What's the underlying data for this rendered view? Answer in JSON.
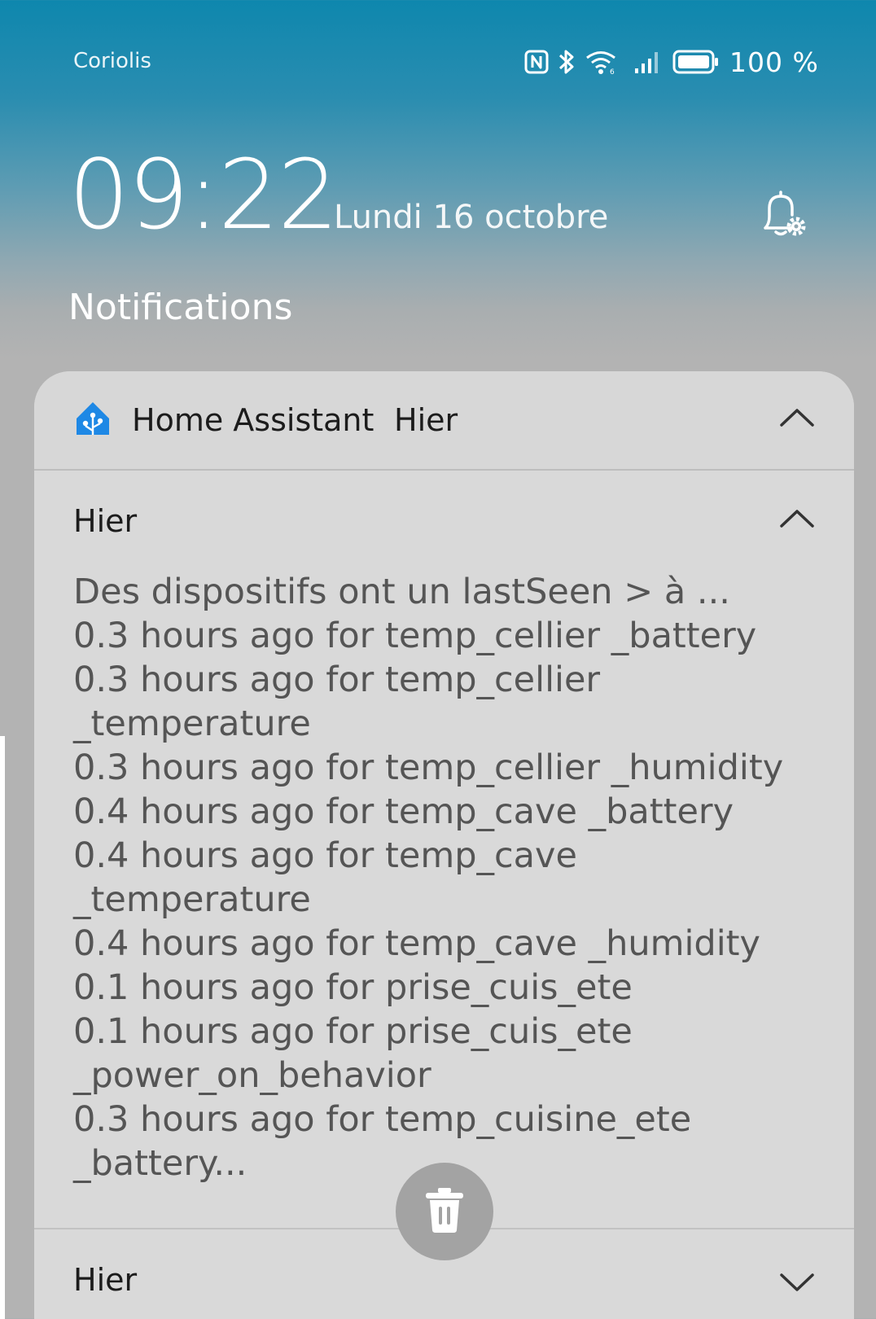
{
  "status_bar": {
    "carrier": "Coriolis",
    "battery_text": "100 %",
    "icons": [
      "nfc-icon",
      "bluetooth-icon",
      "wifi-icon",
      "signal-icon",
      "battery-icon"
    ]
  },
  "lockscreen": {
    "time": "09:22",
    "date": "Lundi 16 octobre",
    "bell_icon": "notification-settings-icon"
  },
  "section_title": "Notifications",
  "group": {
    "app_name": "Home Assistant",
    "time": "Hier",
    "app_icon": "home-assistant-icon",
    "accent": "#1e88e5"
  },
  "notifications": [
    {
      "title": "Hier",
      "expanded": true,
      "body": "Des dispositifs ont un lastSeen > à ...\n0.3 hours ago for temp_cellier _battery\n0.3 hours ago for temp_cellier\n_temperature\n0.3 hours ago for temp_cellier _humidity\n0.4 hours ago for temp_cave _battery\n0.4 hours ago for temp_cave\n_temperature\n0.4 hours ago for temp_cave _humidity\n0.1 hours ago for prise_cuis_ete\n0.1 hours ago for prise_cuis_ete\n_power_on_behavior\n0.3 hours ago for temp_cuisine_ete\n_battery..."
    },
    {
      "title": "Hier",
      "expanded": false
    }
  ],
  "actions": {
    "delete_icon": "trash-icon"
  }
}
